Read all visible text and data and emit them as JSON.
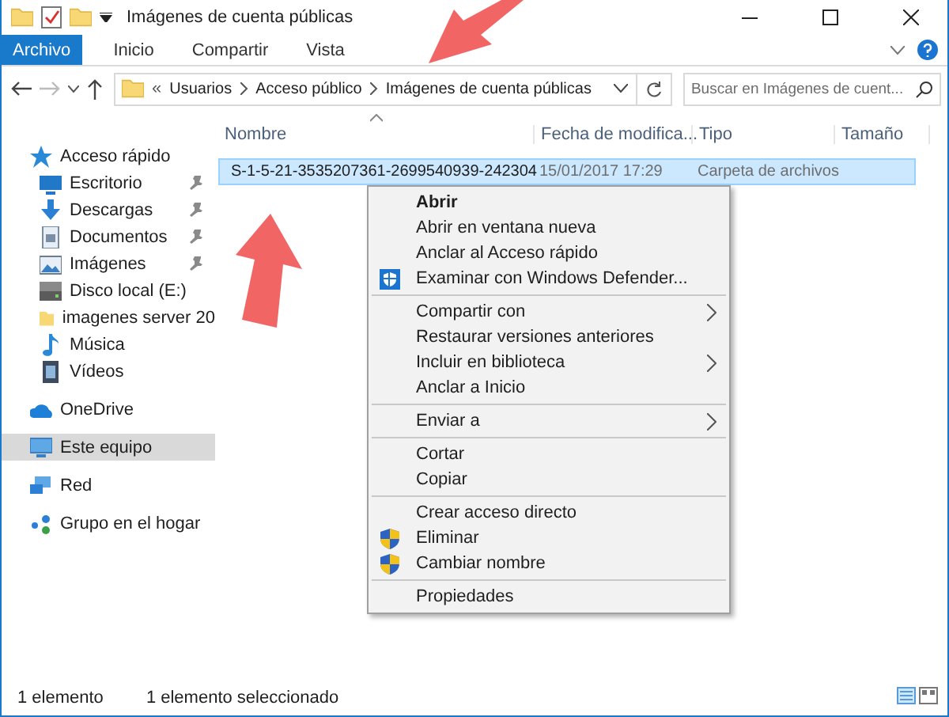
{
  "window": {
    "title": "Imágenes de cuenta públicas"
  },
  "ribbon": {
    "tabs": [
      {
        "label": "Archivo",
        "selected": true
      },
      {
        "label": "Inicio",
        "selected": false
      },
      {
        "label": "Compartir",
        "selected": false
      },
      {
        "label": "Vista",
        "selected": false
      }
    ]
  },
  "address": {
    "overflow": "«",
    "crumbs": [
      "Usuarios",
      "Acceso público",
      "Imágenes de cuenta públicas"
    ]
  },
  "search": {
    "placeholder": "Buscar en Imágenes de cuent..."
  },
  "sidebar": {
    "items": [
      {
        "label": "Acceso rápido",
        "kind": "star",
        "selected": false,
        "children": [
          {
            "label": "Escritorio",
            "kind": "desktop",
            "pinned": true,
            "selected": false
          },
          {
            "label": "Descargas",
            "kind": "download",
            "pinned": true,
            "selected": false
          },
          {
            "label": "Documentos",
            "kind": "document",
            "pinned": true,
            "selected": false
          },
          {
            "label": "Imágenes",
            "kind": "pictures",
            "pinned": true,
            "selected": false
          },
          {
            "label": "Disco local (E:)",
            "kind": "drive",
            "pinned": false,
            "selected": false
          },
          {
            "label": "imagenes server 20",
            "kind": "folder",
            "pinned": false,
            "selected": false
          },
          {
            "label": "Música",
            "kind": "music",
            "pinned": false,
            "selected": false
          },
          {
            "label": "Vídeos",
            "kind": "video",
            "pinned": false,
            "selected": false
          }
        ]
      },
      {
        "label": "OneDrive",
        "kind": "cloud",
        "selected": false
      },
      {
        "label": "Este equipo",
        "kind": "computer",
        "selected": true
      },
      {
        "label": "Red",
        "kind": "network",
        "selected": false
      },
      {
        "label": "Grupo en el hogar",
        "kind": "homegroup",
        "selected": false
      }
    ]
  },
  "table": {
    "columns": [
      "Nombre",
      "Fecha de modifica...",
      "Tipo",
      "Tamaño"
    ],
    "rows": [
      {
        "name": "S-1-5-21-3535207361-2699540939-242304",
        "date": "15/01/2017 17:29",
        "type": "Carpeta de archivos",
        "selected": true
      }
    ]
  },
  "context_menu": {
    "groups": [
      {
        "items": [
          {
            "label": "Abrir",
            "kind": "plain",
            "default": true,
            "submenu": false
          },
          {
            "label": "Abrir en ventana nueva",
            "kind": "plain",
            "default": false,
            "submenu": false
          },
          {
            "label": "Anclar al Acceso rápido",
            "kind": "plain",
            "default": false,
            "submenu": false
          },
          {
            "label": "Examinar con Windows Defender...",
            "kind": "defender",
            "default": false,
            "submenu": false
          }
        ]
      },
      {
        "items": [
          {
            "label": "Compartir con",
            "kind": "plain",
            "default": false,
            "submenu": true
          },
          {
            "label": "Restaurar versiones anteriores",
            "kind": "plain",
            "default": false,
            "submenu": false
          },
          {
            "label": "Incluir en biblioteca",
            "kind": "plain",
            "default": false,
            "submenu": true
          },
          {
            "label": "Anclar a Inicio",
            "kind": "plain",
            "default": false,
            "submenu": false
          }
        ]
      },
      {
        "items": [
          {
            "label": "Enviar a",
            "kind": "plain",
            "default": false,
            "submenu": true
          }
        ]
      },
      {
        "items": [
          {
            "label": "Cortar",
            "kind": "plain",
            "default": false,
            "submenu": false
          },
          {
            "label": "Copiar",
            "kind": "plain",
            "default": false,
            "submenu": false
          }
        ]
      },
      {
        "items": [
          {
            "label": "Crear acceso directo",
            "kind": "plain",
            "default": false,
            "submenu": false
          },
          {
            "label": "Eliminar",
            "kind": "shield",
            "default": false,
            "submenu": false
          },
          {
            "label": "Cambiar nombre",
            "kind": "shield",
            "default": false,
            "submenu": false
          }
        ]
      },
      {
        "items": [
          {
            "label": "Propiedades",
            "kind": "plain",
            "default": false,
            "submenu": false
          }
        ]
      }
    ]
  },
  "status_bar": {
    "items": [
      "1 elemento",
      "1 elemento seleccionado"
    ]
  }
}
